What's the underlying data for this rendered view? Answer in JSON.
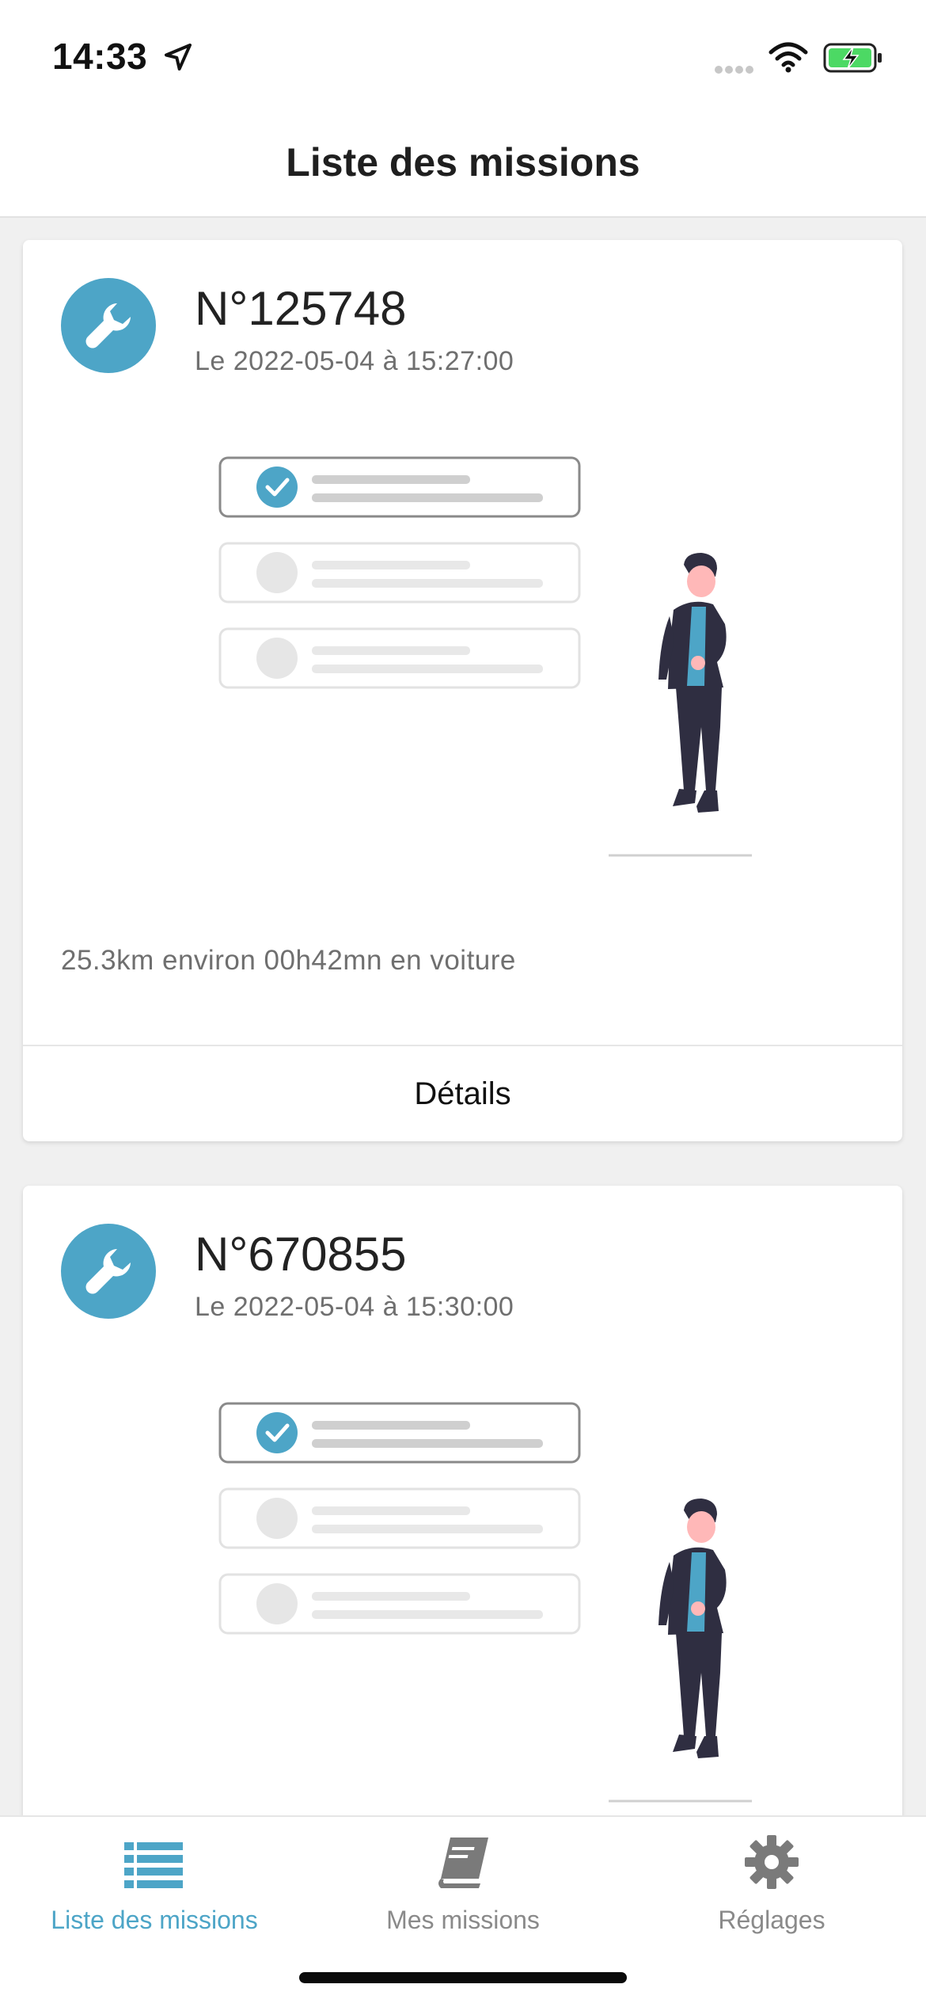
{
  "status_bar": {
    "time": "14:33",
    "icons": [
      "location-arrow-icon",
      "signal-dots-icon",
      "wifi-icon",
      "battery-charging-icon"
    ]
  },
  "header": {
    "title": "Liste des missions"
  },
  "missions": [
    {
      "icon": "wrench-icon",
      "number": "N°125748",
      "date": "Le 2022-05-04 à 15:27:00",
      "distance": "25.3km environ 00h42mn en voiture",
      "details_label": "Détails"
    },
    {
      "icon": "wrench-icon",
      "number": "N°670855",
      "date": "Le 2022-05-04 à 15:30:00"
    }
  ],
  "tab_bar": {
    "tabs": [
      {
        "label": "Liste des missions",
        "icon": "list-icon",
        "active": true
      },
      {
        "label": "Mes missions",
        "icon": "book-icon",
        "active": false
      },
      {
        "label": "Réglages",
        "icon": "gear-icon",
        "active": false
      }
    ]
  },
  "colors": {
    "accent": "#4da5c7",
    "background": "#f0f0f0",
    "card": "#ffffff",
    "text_secondary": "#6f6f6f",
    "illustration_dark": "#2f2e41",
    "illustration_skin": "#ffb8b8"
  }
}
